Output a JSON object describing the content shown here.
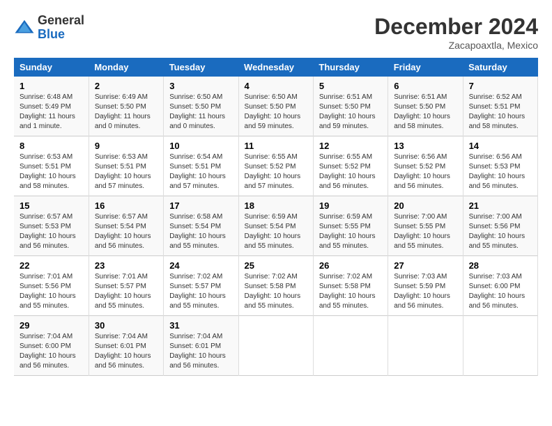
{
  "header": {
    "logo_general": "General",
    "logo_blue": "Blue",
    "month_title": "December 2024",
    "location": "Zacapoaxtla, Mexico"
  },
  "columns": [
    "Sunday",
    "Monday",
    "Tuesday",
    "Wednesday",
    "Thursday",
    "Friday",
    "Saturday"
  ],
  "weeks": [
    [
      {
        "day": "1",
        "sunrise": "6:48 AM",
        "sunset": "5:49 PM",
        "daylight": "11 hours and 1 minute."
      },
      {
        "day": "2",
        "sunrise": "6:49 AM",
        "sunset": "5:50 PM",
        "daylight": "11 hours and 0 minutes."
      },
      {
        "day": "3",
        "sunrise": "6:50 AM",
        "sunset": "5:50 PM",
        "daylight": "11 hours and 0 minutes."
      },
      {
        "day": "4",
        "sunrise": "6:50 AM",
        "sunset": "5:50 PM",
        "daylight": "10 hours and 59 minutes."
      },
      {
        "day": "5",
        "sunrise": "6:51 AM",
        "sunset": "5:50 PM",
        "daylight": "10 hours and 59 minutes."
      },
      {
        "day": "6",
        "sunrise": "6:51 AM",
        "sunset": "5:50 PM",
        "daylight": "10 hours and 58 minutes."
      },
      {
        "day": "7",
        "sunrise": "6:52 AM",
        "sunset": "5:51 PM",
        "daylight": "10 hours and 58 minutes."
      }
    ],
    [
      {
        "day": "8",
        "sunrise": "6:53 AM",
        "sunset": "5:51 PM",
        "daylight": "10 hours and 58 minutes."
      },
      {
        "day": "9",
        "sunrise": "6:53 AM",
        "sunset": "5:51 PM",
        "daylight": "10 hours and 57 minutes."
      },
      {
        "day": "10",
        "sunrise": "6:54 AM",
        "sunset": "5:51 PM",
        "daylight": "10 hours and 57 minutes."
      },
      {
        "day": "11",
        "sunrise": "6:55 AM",
        "sunset": "5:52 PM",
        "daylight": "10 hours and 57 minutes."
      },
      {
        "day": "12",
        "sunrise": "6:55 AM",
        "sunset": "5:52 PM",
        "daylight": "10 hours and 56 minutes."
      },
      {
        "day": "13",
        "sunrise": "6:56 AM",
        "sunset": "5:52 PM",
        "daylight": "10 hours and 56 minutes."
      },
      {
        "day": "14",
        "sunrise": "6:56 AM",
        "sunset": "5:53 PM",
        "daylight": "10 hours and 56 minutes."
      }
    ],
    [
      {
        "day": "15",
        "sunrise": "6:57 AM",
        "sunset": "5:53 PM",
        "daylight": "10 hours and 56 minutes."
      },
      {
        "day": "16",
        "sunrise": "6:57 AM",
        "sunset": "5:54 PM",
        "daylight": "10 hours and 56 minutes."
      },
      {
        "day": "17",
        "sunrise": "6:58 AM",
        "sunset": "5:54 PM",
        "daylight": "10 hours and 55 minutes."
      },
      {
        "day": "18",
        "sunrise": "6:59 AM",
        "sunset": "5:54 PM",
        "daylight": "10 hours and 55 minutes."
      },
      {
        "day": "19",
        "sunrise": "6:59 AM",
        "sunset": "5:55 PM",
        "daylight": "10 hours and 55 minutes."
      },
      {
        "day": "20",
        "sunrise": "7:00 AM",
        "sunset": "5:55 PM",
        "daylight": "10 hours and 55 minutes."
      },
      {
        "day": "21",
        "sunrise": "7:00 AM",
        "sunset": "5:56 PM",
        "daylight": "10 hours and 55 minutes."
      }
    ],
    [
      {
        "day": "22",
        "sunrise": "7:01 AM",
        "sunset": "5:56 PM",
        "daylight": "10 hours and 55 minutes."
      },
      {
        "day": "23",
        "sunrise": "7:01 AM",
        "sunset": "5:57 PM",
        "daylight": "10 hours and 55 minutes."
      },
      {
        "day": "24",
        "sunrise": "7:02 AM",
        "sunset": "5:57 PM",
        "daylight": "10 hours and 55 minutes."
      },
      {
        "day": "25",
        "sunrise": "7:02 AM",
        "sunset": "5:58 PM",
        "daylight": "10 hours and 55 minutes."
      },
      {
        "day": "26",
        "sunrise": "7:02 AM",
        "sunset": "5:58 PM",
        "daylight": "10 hours and 55 minutes."
      },
      {
        "day": "27",
        "sunrise": "7:03 AM",
        "sunset": "5:59 PM",
        "daylight": "10 hours and 56 minutes."
      },
      {
        "day": "28",
        "sunrise": "7:03 AM",
        "sunset": "6:00 PM",
        "daylight": "10 hours and 56 minutes."
      }
    ],
    [
      {
        "day": "29",
        "sunrise": "7:04 AM",
        "sunset": "6:00 PM",
        "daylight": "10 hours and 56 minutes."
      },
      {
        "day": "30",
        "sunrise": "7:04 AM",
        "sunset": "6:01 PM",
        "daylight": "10 hours and 56 minutes."
      },
      {
        "day": "31",
        "sunrise": "7:04 AM",
        "sunset": "6:01 PM",
        "daylight": "10 hours and 56 minutes."
      },
      null,
      null,
      null,
      null
    ]
  ]
}
